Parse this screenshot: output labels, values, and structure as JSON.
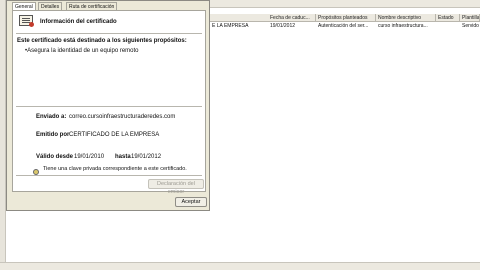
{
  "dialog": {
    "tabs": [
      "General",
      "Detalles",
      "Ruta de certificación"
    ],
    "info_title": "Información del certificado",
    "purposes_heading": "Este certificado está destinado a los siguientes propósitos:",
    "purpose_item": "•Asegura la identidad de un equipo remoto",
    "issued_to_label": "Enviado a:",
    "issued_to_value": "correo.cursoinfraestructuraderedes.com",
    "issued_by_label": "Emitido por",
    "issued_by_value": "CERTIFICADO DE LA EMPRESA",
    "valid_from_label": "Válido desde",
    "valid_from_value": "19/01/2010",
    "valid_to_label": "hasta",
    "valid_to_value": "19/01/2012",
    "private_key_text": "Tiene una clave privada correspondiente a este certificado.",
    "issuer_statement_button": "Declaración del emisor",
    "accept_button": "Aceptar"
  },
  "list": {
    "columns": [
      "Fecha de caduc...",
      "Propósitos planteados",
      "Nombre descriptivo",
      "Estado",
      "Plantilla"
    ],
    "row": {
      "issuer": "E LA EMPRESA",
      "expiry": "19/01/2012",
      "purposes": "Autenticación del ser...",
      "friendly_name": "curso infraestructura...",
      "status": "",
      "template": "Servido"
    }
  }
}
